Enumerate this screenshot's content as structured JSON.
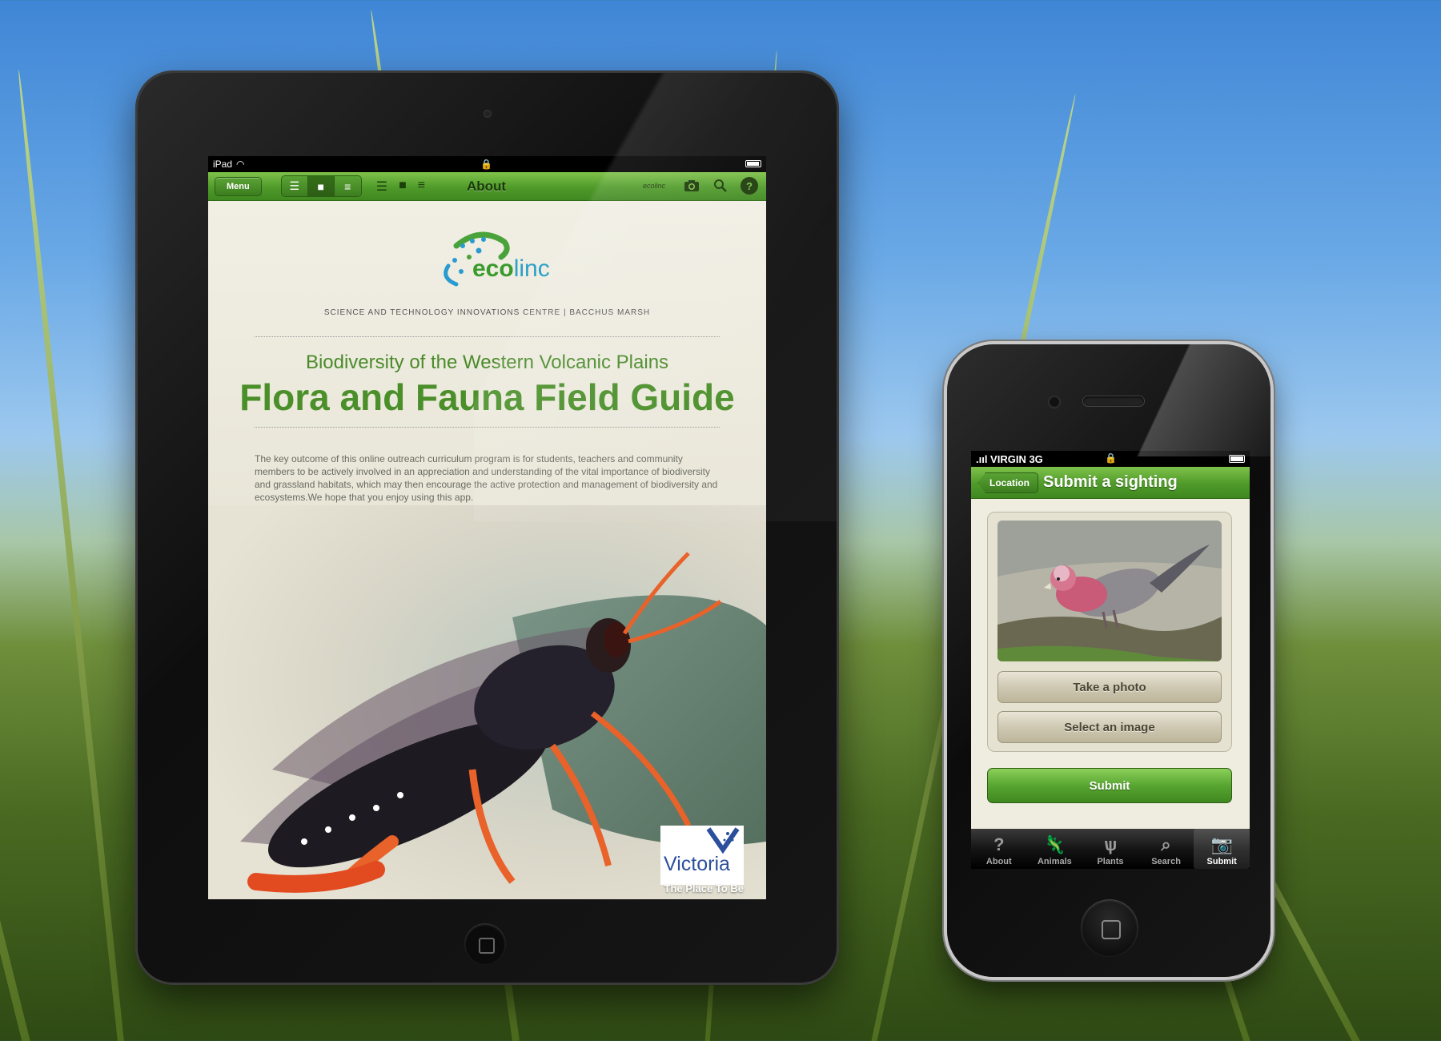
{
  "ipad": {
    "status": {
      "carrier": "iPad",
      "wifi_icon": "wifi-icon",
      "lock_icon": "lock-icon",
      "battery_icon": "battery-icon"
    },
    "toolbar": {
      "menu_label": "Menu",
      "title": "About",
      "layout_icons": [
        "layout-list-icon",
        "layout-page-icon",
        "layout-text-icon"
      ],
      "view_icons": [
        "view-list-icon",
        "view-block-icon",
        "view-text-icon"
      ],
      "logo_text": "ecolinc",
      "right_icons": [
        "camera-icon",
        "search-icon",
        "help-icon"
      ]
    },
    "content": {
      "logo_word_eco": "eco",
      "logo_word_linc": "linc",
      "logo_subtitle": "SCIENCE AND TECHNOLOGY INNOVATIONS CENTRE  |  BACCHUS MARSH",
      "subtitle": "Biodiversity of the Western Volcanic Plains",
      "title": "Flora and Fauna Field Guide",
      "intro": "The key outcome of this online outreach curriculum program is for students, teachers and community members to be actively involved in an appreciation and understanding of the vital  importance of biodiversity and grassland habitats, which may then encourage the active protection and management of biodiversity and ecosystems.We hope that you enjoy using this app.",
      "victoria_word": "Victoria",
      "victoria_tagline": "The Place To Be"
    }
  },
  "iphone": {
    "status": {
      "carrier": ".ııl VIRGIN  3G",
      "lock_icon": "lock-icon",
      "battery_icon": "battery-icon"
    },
    "nav": {
      "back_label": "Location",
      "title": "Submit a sighting"
    },
    "buttons": {
      "take_photo": "Take a photo",
      "select_image": "Select an image",
      "submit": "Submit"
    },
    "tabs": [
      {
        "label": "About",
        "icon": "help-icon",
        "glyph": "?",
        "active": false
      },
      {
        "label": "Animals",
        "icon": "lizard-icon",
        "glyph": "🦎",
        "active": false
      },
      {
        "label": "Plants",
        "icon": "grass-icon",
        "glyph": "ѱ",
        "active": false
      },
      {
        "label": "Search",
        "icon": "search-icon",
        "glyph": "⌕",
        "active": false
      },
      {
        "label": "Submit",
        "icon": "camera-icon",
        "glyph": "📷",
        "active": true
      }
    ]
  }
}
